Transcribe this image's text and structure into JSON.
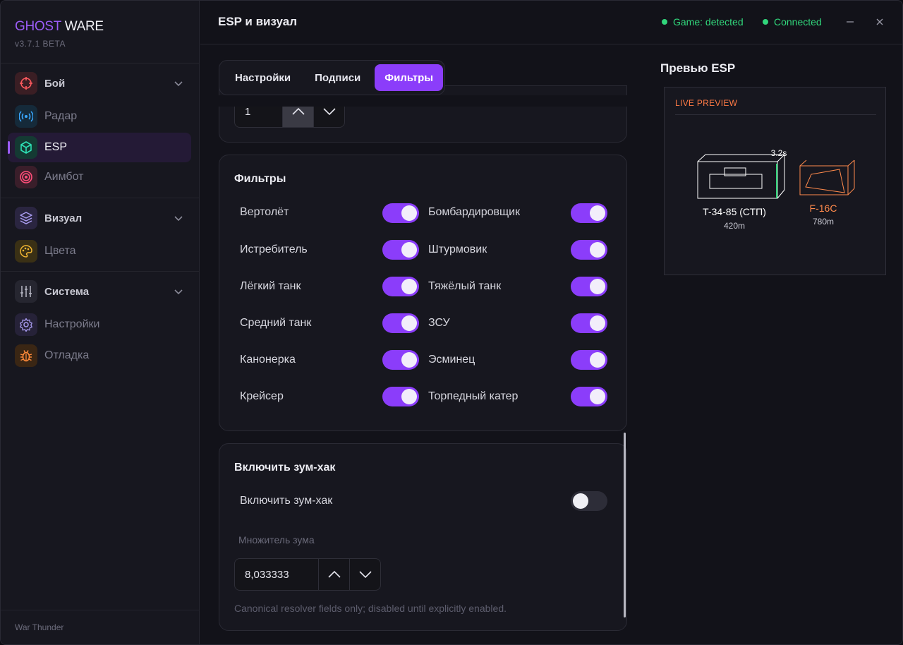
{
  "app": {
    "brand_a": "GHOST",
    "brand_b": "WARE",
    "version": "v3.7.1 BETA",
    "footer": "War Thunder"
  },
  "nav": {
    "combat": "Бой",
    "radar": "Радар",
    "esp": "ESP",
    "aimbot": "Аимбот",
    "visual": "Визуал",
    "colors": "Цвета",
    "system": "Система",
    "settings": "Настройки",
    "debug": "Отладка"
  },
  "header": {
    "title": "ESP и визуал",
    "game_status": "Game: detected",
    "conn_status": "Connected"
  },
  "tabs": {
    "settings": "Настройки",
    "labels": "Подписи",
    "filters": "Фильтры",
    "active": "Фильтры"
  },
  "top_stepper": {
    "value": "1"
  },
  "filters": {
    "title": "Фильтры",
    "items": [
      {
        "label": "Вертолёт",
        "on": true
      },
      {
        "label": "Бомбардировщик",
        "on": true
      },
      {
        "label": "Истребитель",
        "on": true
      },
      {
        "label": "Штурмовик",
        "on": true
      },
      {
        "label": "Лёгкий танк",
        "on": true
      },
      {
        "label": "Тяжёлый танк",
        "on": true
      },
      {
        "label": "Средний танк",
        "on": true
      },
      {
        "label": "ЗСУ",
        "on": true
      },
      {
        "label": "Канонерка",
        "on": true
      },
      {
        "label": "Эсминец",
        "on": true
      },
      {
        "label": "Крейсер",
        "on": true
      },
      {
        "label": "Торпедный катер",
        "on": true
      }
    ]
  },
  "zoom": {
    "title": "Включить зум-хак",
    "toggle_label": "Включить зум-хак",
    "toggle_on": false,
    "multiplier_label": "Множитель зума",
    "multiplier_value": "8,033333",
    "hint": "Canonical resolver fields only; disabled until explicitly enabled."
  },
  "preview": {
    "title": "Превью ESP",
    "header": "LIVE PREVIEW",
    "target1": {
      "name": "T-34-85 (СТП)",
      "distance": "420m",
      "reload": "3.2s",
      "color": "#ffffff"
    },
    "target2": {
      "name": "F-16C",
      "distance": "780m",
      "color": "#ff8a4c"
    }
  },
  "colors": {
    "accent": "#8b3dfa",
    "status_green": "#31d67b",
    "preview_orange": "#ff7a45"
  }
}
